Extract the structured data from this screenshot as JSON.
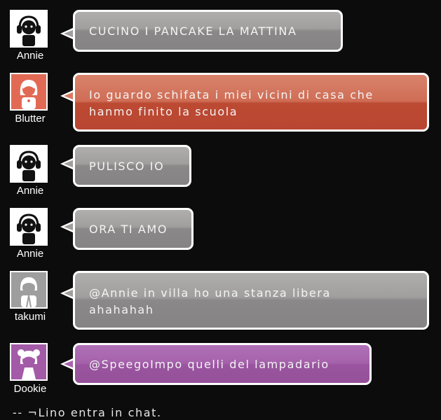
{
  "chat": {
    "messages": [
      {
        "user": "Annie",
        "text": "CUCINO I PANCAKE LA MATTINA",
        "bubble_color": "#8a8888",
        "avatar": "annie-avatar-icon"
      },
      {
        "user": "Blutter",
        "text_lines": [
          "Io guardo schifata i miei vicini di casa che",
          "hanmo finito la scuola"
        ],
        "bubble_color": "#c0503a",
        "avatar": "blutter-avatar-icon"
      },
      {
        "user": "Annie",
        "text": "PULISCO IO",
        "bubble_color": "#8a8888",
        "avatar": "annie-avatar-icon"
      },
      {
        "user": "Annie",
        "text": "ORA TI AMO",
        "bubble_color": "#8a8888",
        "avatar": "annie-avatar-icon"
      },
      {
        "user": "takumi",
        "text_lines": [
          "@Annie in villa ho una stanza libera",
          "ahahahah"
        ],
        "bubble_color": "#8a8888",
        "avatar": "takumi-avatar-icon"
      },
      {
        "user": "Dookie",
        "text": "@SpeegoImpo quelli del lampadario",
        "bubble_color": "#9a55a0",
        "avatar": "dookie-avatar-icon"
      }
    ],
    "system_message": "-- ¬Lino entra in chat."
  }
}
